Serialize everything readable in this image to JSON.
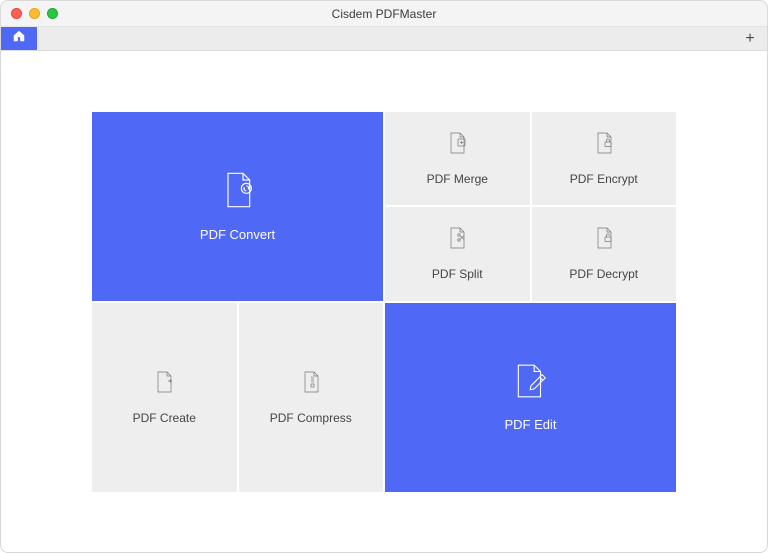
{
  "window": {
    "title": "Cisdem PDFMaster"
  },
  "tabs": {
    "add_glyph": "+"
  },
  "tiles": {
    "convert": {
      "label": "PDF Convert"
    },
    "merge": {
      "label": "PDF Merge"
    },
    "encrypt": {
      "label": "PDF Encrypt"
    },
    "split": {
      "label": "PDF Split"
    },
    "decrypt": {
      "label": "PDF Decrypt"
    },
    "create": {
      "label": "PDF Create"
    },
    "compress": {
      "label": "PDF Compress"
    },
    "edit": {
      "label": "PDF Edit"
    }
  },
  "colors": {
    "accent": "#4f68f5",
    "tile_bg": "#eeeeee"
  }
}
